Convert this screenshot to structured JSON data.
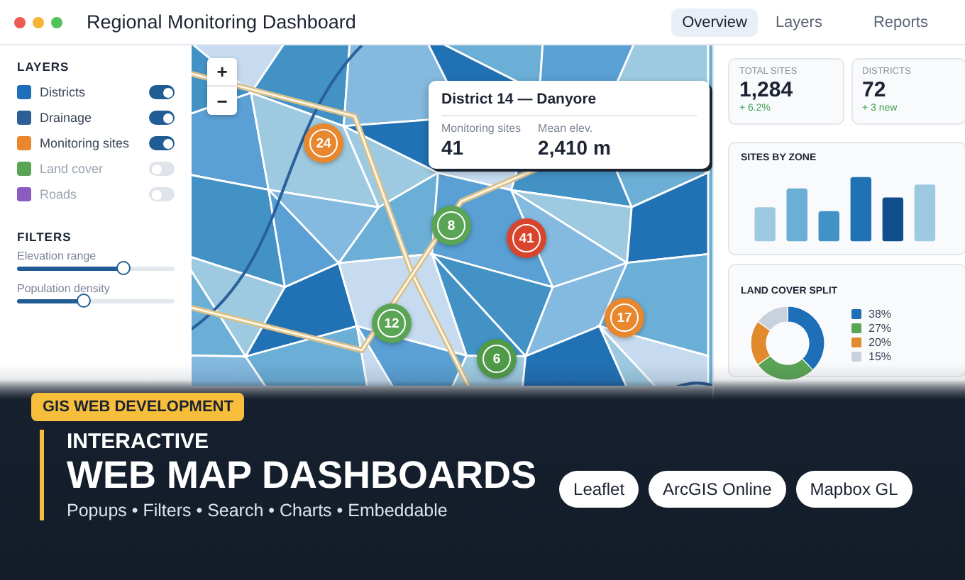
{
  "window": {
    "title": "Regional Monitoring Dashboard"
  },
  "tabs": [
    {
      "label": "Overview",
      "selected": true
    },
    {
      "label": "Layers",
      "selected": false
    },
    {
      "label": "Reports",
      "selected": false
    }
  ],
  "sidebar": {
    "layers_heading": "LAYERS",
    "layers": [
      {
        "label": "Districts",
        "color": "#1f6fb8",
        "on": true
      },
      {
        "label": "Drainage",
        "color": "#2d5f96",
        "on": true
      },
      {
        "label": "Monitoring sites",
        "color": "#e8872e",
        "on": true
      },
      {
        "label": "Land cover",
        "color": "#5aa455",
        "on": false
      },
      {
        "label": "Roads",
        "color": "#8a5cc0",
        "on": false
      }
    ],
    "filters_heading": "FILTERS",
    "filters": [
      {
        "label": "Elevation range",
        "level": 0.68
      },
      {
        "label": "Population density",
        "level": 0.42
      }
    ]
  },
  "map": {
    "zoom_in": "+",
    "zoom_out": "−",
    "markers": [
      {
        "label": "24",
        "color": "#e8872e"
      },
      {
        "label": "8",
        "color": "#5aa455"
      },
      {
        "label": "41",
        "color": "#d9442c"
      },
      {
        "label": "12",
        "color": "#5aa455"
      },
      {
        "label": "17",
        "color": "#e8872e"
      },
      {
        "label": "6",
        "color": "#4f9b48"
      }
    ],
    "popup": {
      "title": "District 14 — Danyore",
      "fields": [
        {
          "label": "Monitoring sites",
          "value": "41"
        },
        {
          "label": "Mean elev.",
          "value": "2,410 m"
        }
      ]
    }
  },
  "stats": [
    {
      "label": "TOTAL SITES",
      "value": "1,284",
      "delta": "+ 6.2%"
    },
    {
      "label": "DISTRICTS",
      "value": "72",
      "delta": "+ 3 new"
    }
  ],
  "sites_by_zone": {
    "title": "SITES BY ZONE"
  },
  "land_cover": {
    "title": "LAND COVER SPLIT",
    "chart_data": {
      "type": "donut",
      "values": [
        38,
        27,
        20,
        15
      ]
    },
    "legend": [
      {
        "label": "38%",
        "color": "#1f6fb8"
      },
      {
        "label": "27%",
        "color": "#5aa455"
      },
      {
        "label": "20%",
        "color": "#e08a2c"
      },
      {
        "label": "15%",
        "color": "#c9d2dc"
      }
    ]
  },
  "banner": {
    "badge": "GIS WEB DEVELOPMENT",
    "kicker": "INTERACTIVE",
    "headline": "WEB MAP DASHBOARDS",
    "features": "Popups • Filters • Search • Charts • Embeddable",
    "pills": [
      "Leaflet",
      "ArcGIS Online",
      "Mapbox GL"
    ]
  }
}
